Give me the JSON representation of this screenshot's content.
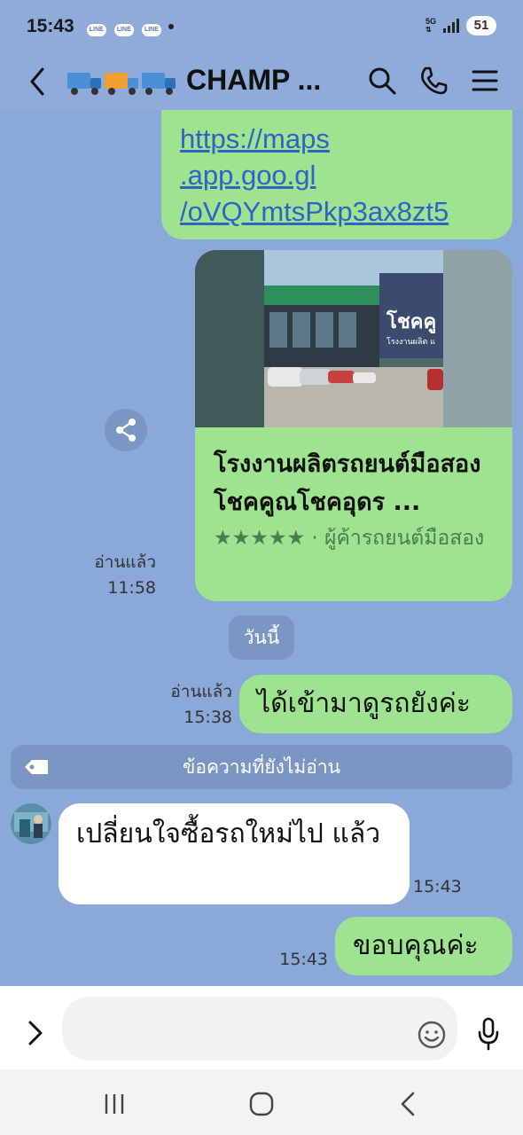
{
  "status": {
    "time": "15:43",
    "app_badges": [
      "LINE",
      "LINE",
      "LINE"
    ],
    "network": "5G",
    "battery": "51"
  },
  "header": {
    "title": "CHAMP ...",
    "icons": [
      "back-icon",
      "trucks-emoji",
      "search-icon",
      "phone-icon",
      "menu-icon"
    ]
  },
  "messages": {
    "link_lines": [
      "https://maps",
      ".app.goo.gl",
      "/oVQYmtsPkp3ax8zt5"
    ],
    "card": {
      "title": "โรงงานผลิตรถยนต์มือสอง โชคคูณโชคอุดร ...",
      "stars": "★★★★★",
      "subtitle": " · ผู้ค้ารถยนต์มือสอง",
      "image_sign": "โชคคู",
      "image_sign_sub": "โรงงานผลิต แ"
    },
    "card_read": "อ่านแล้ว",
    "card_time": "11:58",
    "day_label": "วันนี้",
    "out1_read": "อ่านแล้ว",
    "out1_time": "15:38",
    "out1_text": "ได้เข้ามาดูรถยังค่ะ",
    "unread_label": "ข้อความที่ยังไม่อ่าน",
    "in1_text": "เปลี่ยนใจซื้อรถใหม่ไป แล้ว",
    "in1_time": "15:43",
    "out2_text": "ขอบคุณค่ะ",
    "out2_time": "15:43"
  },
  "input": {
    "placeholder": ""
  },
  "colors": {
    "chat_bg": "#8aa8d8",
    "out_bubble": "#9ee38f",
    "in_bubble": "#ffffff",
    "link": "#2f63c8",
    "pill": "#7a96c2"
  }
}
